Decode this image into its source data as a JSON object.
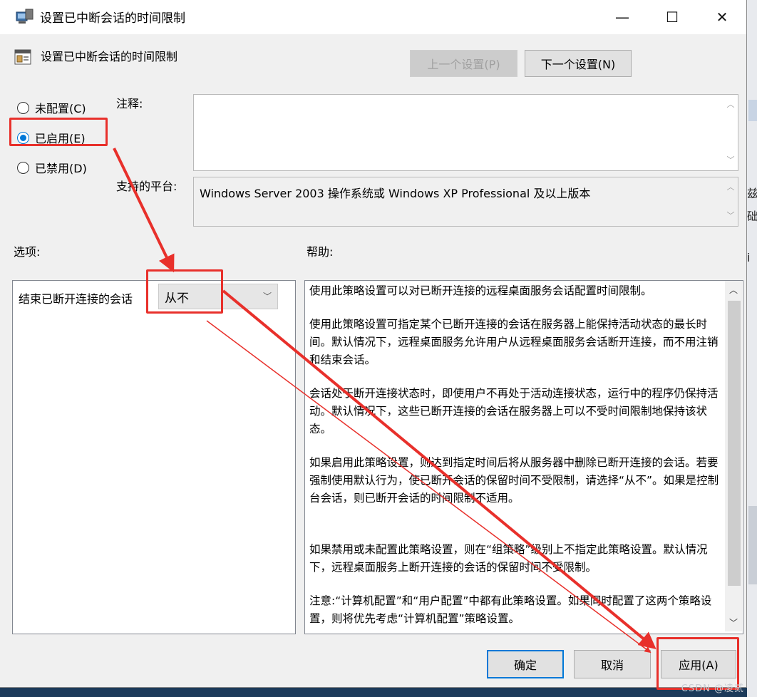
{
  "window": {
    "title": "设置已中断会话的时间限制",
    "controls": {
      "minimize": "—",
      "maximize": "☐",
      "close": "✕"
    }
  },
  "header": {
    "setting_title": "设置已中断会话的时间限制",
    "prev_button": "上一个设置(P)",
    "next_button": "下一个设置(N)"
  },
  "state": {
    "options": [
      {
        "label": "未配置(C)",
        "selected": false
      },
      {
        "label": "已启用(E)",
        "selected": true
      },
      {
        "label": "已禁用(D)",
        "selected": false
      }
    ]
  },
  "comment": {
    "label": "注释:",
    "value": ""
  },
  "platform": {
    "label": "支持的平台:",
    "value": "Windows Server 2003 操作系统或 Windows XP Professional 及以上版本"
  },
  "options_section": {
    "label": "选项:",
    "field_label": "结束已断开连接的会话",
    "dropdown_value": "从不"
  },
  "help_section": {
    "label": "帮助:",
    "paragraphs": [
      "使用此策略设置可以对已断开连接的远程桌面服务会话配置时间限制。",
      "使用此策略设置可指定某个已断开连接的会话在服务器上能保持活动状态的最长时间。默认情况下，远程桌面服务允许用户从远程桌面服务会话断开连接，而不用注销和结束会话。",
      "会话处于断开连接状态时，即使用户不再处于活动连接状态，运行中的程序仍保持活动。默认情况下，这些已断开连接的会话在服务器上可以不受时间限制地保持该状态。",
      "如果启用此策略设置，则达到指定时间后将从服务器中删除已断开连接的会话。若要强制使用默认行为，使已断开会话的保留时间不受限制，请选择“从不”。如果是控制台会话，则已断开会话的时间限制不适用。",
      "如果禁用或未配置此策略设置，则在“组策略”级别上不指定此策略设置。默认情况下，远程桌面服务上断开连接的会话的保留时间不受限制。",
      "注意:“计算机配置”和“用户配置”中都有此策略设置。如果同时配置了这两个策略设置，则将优先考虑“计算机配置”策略设置。"
    ]
  },
  "footer": {
    "ok_button": "确定",
    "cancel_button": "取消",
    "apply_button": "应用(A)"
  },
  "background": {
    "fragments": [
      "兹",
      "础",
      "i"
    ]
  },
  "watermark": "CSDN @凌贰",
  "colors": {
    "accent": "#0078d7",
    "annotation": "#e8302b"
  }
}
